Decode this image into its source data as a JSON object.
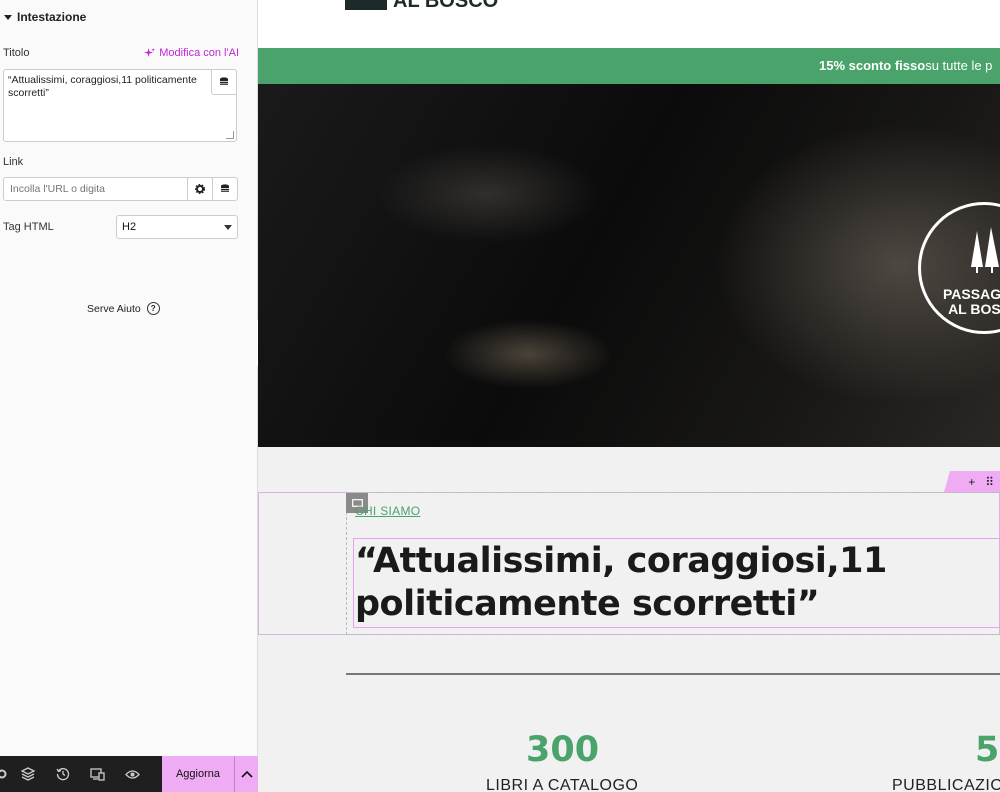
{
  "panel": {
    "section_title": "Intestazione",
    "title_label": "Titolo",
    "ai_link": "Modifica con l'AI",
    "title_value": "“Attualissimi, coraggiosi,11 politicamente scorretti”",
    "link_label": "Link",
    "link_placeholder": "Incolla l'URL o digita",
    "tag_label": "Tag HTML",
    "tag_value": "H2",
    "help": "Serve Aiuto",
    "update_button": "Aggiorna"
  },
  "preview": {
    "logo_text": "AL BOSCO",
    "promo_bold": "15% sconto fisso",
    "promo_rest": " su tutte le p",
    "badge_line1": "PASSAGGIO",
    "badge_line2": "AL BOSCO",
    "kicker": "CHI SIAMO",
    "headline": "“Attualissimi, coraggiosi,11 politicamente scorretti”",
    "stats": [
      {
        "number": "300",
        "label": "LIBRI A CATALOGO"
      },
      {
        "number": "5",
        "label": "PUBBLICAZIONI"
      }
    ]
  },
  "colors": {
    "accent_green": "#4aa36a",
    "editor_pink": "#f0abf5",
    "ai_magenta": "#c026d3"
  }
}
